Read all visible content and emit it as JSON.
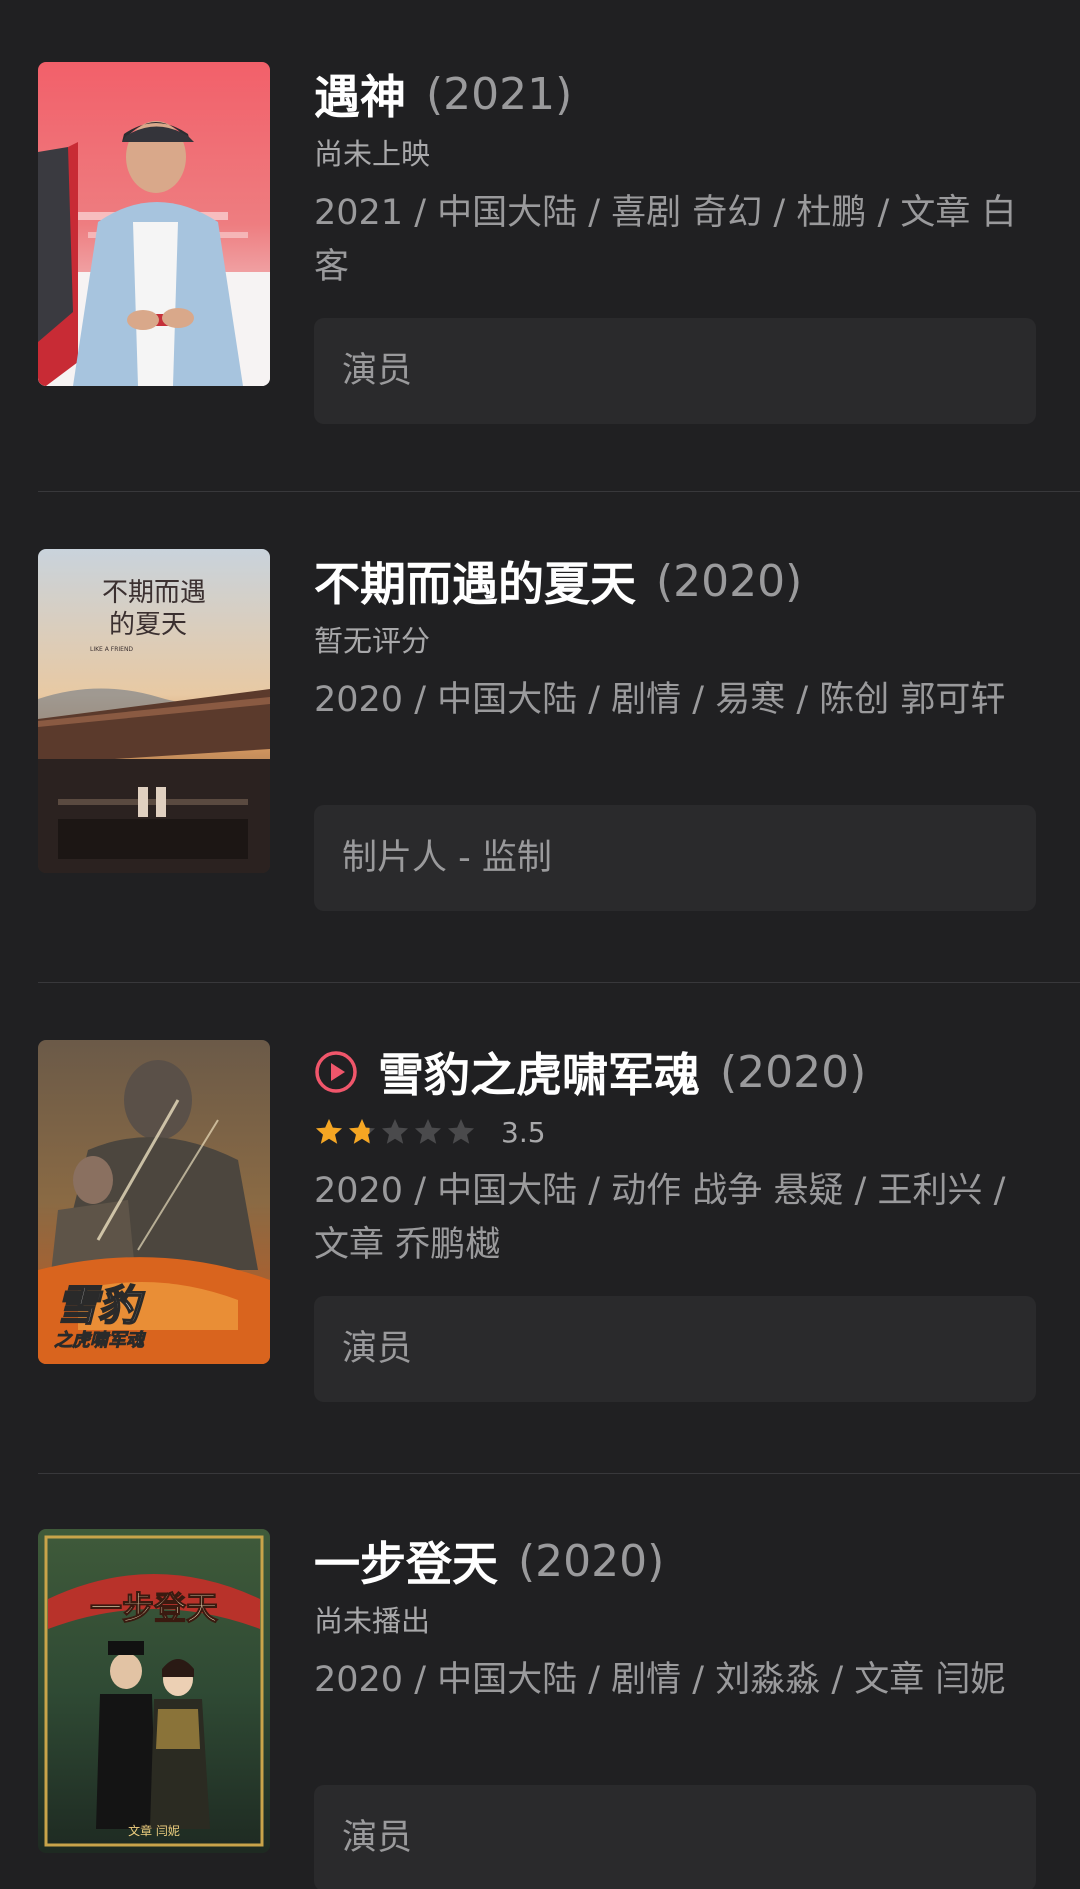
{
  "items": [
    {
      "title": "遇神",
      "year": "(2021)",
      "status": "尚未上映",
      "meta": "2021 / 中国大陆 / 喜剧 奇幻 / 杜鹏 / 文章 白客",
      "role": "演员"
    },
    {
      "title": "不期而遇的夏天",
      "year": "(2020)",
      "status": "暂无评分",
      "meta": "2020 / 中国大陆 / 剧情 / 易寒 / 陈创 郭可轩",
      "role": "制片人 - 监制",
      "poster_text": {
        "title_line1": "不期而遇",
        "title_line2": "的夏天",
        "subtitle": "LIKE A FRIEND"
      }
    },
    {
      "title": "雪豹之虎啸军魂",
      "year": "(2020)",
      "rating": "3.5",
      "rating_fraction": 0.35,
      "meta": "2020 / 中国大陆 / 动作 战争 悬疑 / 王利兴 / 文章 乔鹏樾",
      "role": "演员",
      "play_icon": "play-circle-icon",
      "poster_text": {
        "title_line1": "雪豹",
        "title_line2": "之虎啸军魂"
      }
    },
    {
      "title": "一步登天",
      "year": "(2020)",
      "status": "尚未播出",
      "meta": "2020 / 中国大陆 / 剧情 / 刘淼淼 / 文章 闫妮",
      "role": "演员",
      "poster_text": {
        "title": "一步登天",
        "cast": "文章 闫妮"
      }
    }
  ],
  "colors": {
    "background": "#202022",
    "card": "#2a2a2c",
    "star_active": "#f5a623",
    "star_inactive": "#4a4a4c",
    "play_accent": "#f0566b"
  }
}
